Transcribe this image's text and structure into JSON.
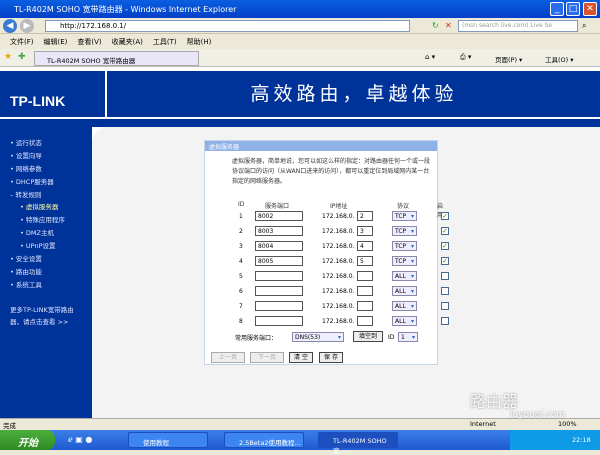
{
  "window": {
    "title": "TL-R402M SOHO 宽带路由器 - Windows Internet Explorer",
    "minimize": "_",
    "maximize": "□",
    "close": "✕"
  },
  "address": {
    "url": "http://172.168.0.1/",
    "search_placeholder": "(msn search live.com) Live Se"
  },
  "menu": [
    "文件(F)",
    "编辑(E)",
    "查看(V)",
    "收藏夹(A)",
    "工具(T)",
    "帮助(H)"
  ],
  "tab": {
    "label": "TL-R402M SOHO 宽带路由器"
  },
  "toolbar_right": {
    "page": "页面(P) ▾",
    "tools": "工具(O) ▾"
  },
  "banner": {
    "logo": "TP-LINK",
    "slogan": "高效路由，卓越体验"
  },
  "sidebar": {
    "items": [
      "• 运行状态",
      "• 设置向导",
      "• 网络参数",
      "• DHCP服务器",
      "– 转发规则",
      "• 虚拟服务器",
      "• 特殊应用程序",
      "• DMZ主机",
      "• UPnP设置",
      "• 安全设置",
      "• 路由功能",
      "• 系统工具"
    ],
    "more_line1": "更多TP-LINK宽带路由",
    "more_line2": "器，请点击查看 >>"
  },
  "panel": {
    "title": "虚拟服务器",
    "description": "虚拟服务器，简单地说，您可以如这么样的指定：对路由器任何一个或一段协议端口的访问（从WAN口进来的访问），都可以重定位到局域网内某一台指定的网络服务器。",
    "headers": {
      "id": "ID",
      "port": "服务端口",
      "ip": "IP地址",
      "protocol": "协议",
      "enabled": "启用"
    },
    "ip_prefix": "172.168.0.",
    "rows": [
      {
        "id": "1",
        "port": "8002",
        "ip": "2",
        "protocol": "TCP",
        "enabled": true
      },
      {
        "id": "2",
        "port": "8003",
        "ip": "3",
        "protocol": "TCP",
        "enabled": true
      },
      {
        "id": "3",
        "port": "8004",
        "ip": "4",
        "protocol": "TCP",
        "enabled": true
      },
      {
        "id": "4",
        "port": "8005",
        "ip": "5",
        "protocol": "TCP",
        "enabled": true
      },
      {
        "id": "5",
        "port": "",
        "ip": "",
        "protocol": "ALL",
        "enabled": false
      },
      {
        "id": "6",
        "port": "",
        "ip": "",
        "protocol": "ALL",
        "enabled": false
      },
      {
        "id": "7",
        "port": "",
        "ip": "",
        "protocol": "ALL",
        "enabled": false
      },
      {
        "id": "8",
        "port": "",
        "ip": "",
        "protocol": "ALL",
        "enabled": false
      }
    ],
    "common_label": "常用服务端口：",
    "common_value": "DNS(53)",
    "fill_button": "填空到",
    "id_label": "ID",
    "id_value": "1",
    "prev": "上一页",
    "next": "下一页",
    "clear": "清 空",
    "save": "保 存"
  },
  "status": {
    "text": "完成",
    "zone": "Internet",
    "zoom": "100%"
  },
  "taskbar": {
    "start": "开始",
    "tasks": [
      "使用教程",
      "2.5Beta2使用教程...",
      "TL-R402M SOHO 宽..."
    ],
    "clock": "22:18"
  },
  "watermark": {
    "title": "路由器",
    "url": "luyouqi.com"
  }
}
